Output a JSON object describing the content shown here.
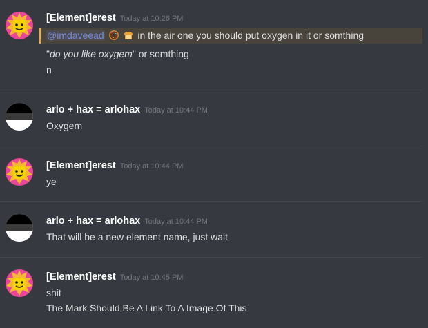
{
  "messages": [
    {
      "author": "[Element]erest",
      "timestamp": "Today at 10:26 PM",
      "avatar": "lego-head-avatar",
      "lines": [
        {
          "mention": "@imdaveead",
          "emojis": [
            "doughnut",
            "bread"
          ],
          "text": "in the air one you should put oxygen in it or somthing",
          "highlighted": true
        },
        {
          "quote_open": "\"",
          "italic": "do you like oxygem",
          "quote_close": "\" or somthing"
        },
        {
          "text": "n"
        }
      ]
    },
    {
      "author": "arlo + hax = arlohax",
      "timestamp": "Today at 10:44 PM",
      "avatar": "striped-circle-avatar",
      "lines": [
        {
          "text": "Oxygem"
        }
      ]
    },
    {
      "author": "[Element]erest",
      "timestamp": "Today at 10:44 PM",
      "avatar": "lego-head-avatar",
      "lines": [
        {
          "text": "ye"
        }
      ]
    },
    {
      "author": "arlo + hax = arlohax",
      "timestamp": "Today at 10:44 PM",
      "avatar": "striped-circle-avatar",
      "lines": [
        {
          "text": "That will be a new element name, just wait"
        }
      ]
    },
    {
      "author": "[Element]erest",
      "timestamp": "Today at 10:45 PM",
      "avatar": "lego-head-avatar",
      "lines": [
        {
          "text": "shit"
        },
        {
          "text": "The Mark Should Be A Link To A Image Of This"
        }
      ]
    }
  ],
  "colors": {
    "background": "#36393f",
    "mention": "#7289da",
    "highlight_bar": "#faa81a",
    "username": "#ffffff",
    "timestamp": "#72767d"
  }
}
